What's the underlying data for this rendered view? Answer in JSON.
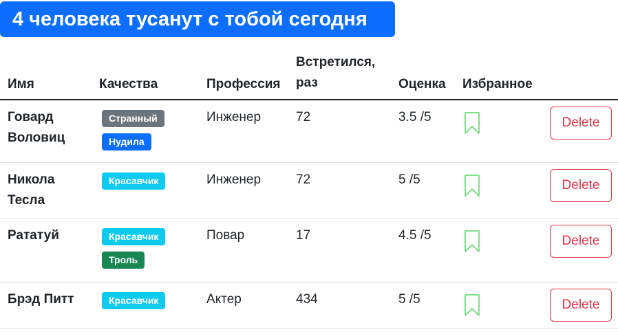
{
  "banner": {
    "text": "4 человека тусанут с тобой сегодня",
    "color": "#0d6efd"
  },
  "table": {
    "headers": {
      "name": "Имя",
      "qualities": "Качества",
      "profession": "Профессия",
      "met": "Встретился, раз",
      "rating": "Оценка",
      "favorite": "Избранное"
    },
    "rows": [
      {
        "name": "Говард Воловиц",
        "qualities": [
          {
            "label": "Странный",
            "color": "#6c757d"
          },
          {
            "label": "Нудила",
            "color": "#0d6efd"
          }
        ],
        "profession": "Инженер",
        "met": "72",
        "rating": "3.5 /5",
        "favorite_icon": "bookmark-icon",
        "delete_label": "Delete"
      },
      {
        "name": "Никола Тесла",
        "qualities": [
          {
            "label": "Красавчик",
            "color": "#0dcaf0"
          }
        ],
        "profession": "Инженер",
        "met": "72",
        "rating": "5 /5",
        "favorite_icon": "bookmark-icon",
        "delete_label": "Delete"
      },
      {
        "name": "Рататуй",
        "qualities": [
          {
            "label": "Красавчик",
            "color": "#0dcaf0"
          },
          {
            "label": "Троль",
            "color": "#198754"
          }
        ],
        "profession": "Повар",
        "met": "17",
        "rating": "4.5 /5",
        "favorite_icon": "bookmark-icon",
        "delete_label": "Delete"
      },
      {
        "name": "Брэд Питт",
        "qualities": [
          {
            "label": "Красавчик",
            "color": "#0dcaf0"
          }
        ],
        "profession": "Актер",
        "met": "434",
        "rating": "5 /5",
        "favorite_icon": "bookmark-icon",
        "delete_label": "Delete"
      }
    ]
  },
  "colors": {
    "bookmark": "#7fe08a",
    "delete": "#dc3545"
  }
}
